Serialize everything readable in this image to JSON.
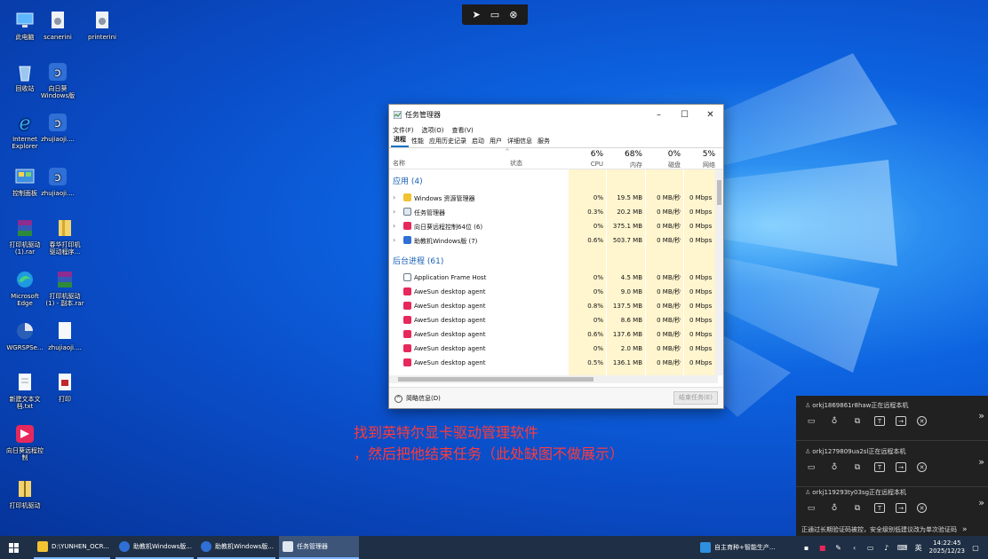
{
  "colors": {
    "desktop": "#0a4fd8",
    "accent": "#1a73c7",
    "instruction_text": "#ff3a3a",
    "taskbar": "#1f2f45",
    "panel": "#212121",
    "resource_highlight": "#fff5cf"
  },
  "desktop": {
    "icons": [
      {
        "label": "此电脑",
        "icon": "computer-icon"
      },
      {
        "label": "scanerini",
        "icon": "ini-file-icon"
      },
      {
        "label": "printerini",
        "icon": "ini-file-icon"
      },
      {
        "label": "回收站",
        "icon": "recycle-bin-icon"
      },
      {
        "label": "向日葵\nWindows版",
        "icon": "sunlogin-icon"
      },
      {
        "label": "Internet\nExplorer",
        "icon": "ie-icon"
      },
      {
        "label": "zhujiaoji....",
        "icon": "sunlogin-icon"
      },
      {
        "label": "控制面板",
        "icon": "control-panel-icon"
      },
      {
        "label": "zhujiaoji....",
        "icon": "sunlogin-icon"
      },
      {
        "label": "打印机驱动\n(1).rar",
        "icon": "rar-icon"
      },
      {
        "label": "春华打印机\n驱动程序...",
        "icon": "folder-icon"
      },
      {
        "label": "Microsoft\nEdge",
        "icon": "edge-icon"
      },
      {
        "label": "打印机驱动\n(1) - 副本.rar",
        "icon": "rar-icon"
      },
      {
        "label": "WGRSPSe...",
        "icon": "wgrsp-icon"
      },
      {
        "label": "zhujiaoji....",
        "icon": "file-icon"
      },
      {
        "label": "新建文本文\n档.txt",
        "icon": "text-file-icon"
      },
      {
        "label": "打印",
        "icon": "print-doc-icon"
      },
      {
        "label": "向日葵远程控\n制",
        "icon": "sunlogin-remote-icon"
      },
      {
        "label": "打印机驱动",
        "icon": "zip-folder-icon"
      }
    ]
  },
  "remote_toolbar": {
    "icons": [
      "pointer-icon",
      "screen-icon",
      "close-circle-icon"
    ]
  },
  "task_manager": {
    "title": "任务管理器",
    "menu": [
      "文件(F)",
      "选项(O)",
      "查看(V)"
    ],
    "tabs": [
      "进程",
      "性能",
      "应用历史记录",
      "启动",
      "用户",
      "详细信息",
      "服务"
    ],
    "active_tab": "进程",
    "header": {
      "name": "名称",
      "status": "状态",
      "cpu_pct": "6%",
      "cpu": "CPU",
      "mem_pct": "68%",
      "mem": "内存",
      "disk_pct": "0%",
      "disk": "磁盘",
      "net_pct": "5%",
      "net": "网络"
    },
    "groups": {
      "apps": "应用 (4)",
      "background": "后台进程 (61)"
    },
    "apps": [
      {
        "name": "Windows 资源管理器",
        "cpu": "0%",
        "mem": "19.5 MB",
        "disk": "0 MB/秒",
        "net": "0 Mbps",
        "icon": "explorer-icon"
      },
      {
        "name": "任务管理器",
        "cpu": "0.3%",
        "mem": "20.2 MB",
        "disk": "0 MB/秒",
        "net": "0 Mbps",
        "icon": "taskmgr-icon"
      },
      {
        "name": "向日葵远程控制64位 (6)",
        "cpu": "0%",
        "mem": "375.1 MB",
        "disk": "0 MB/秒",
        "net": "0 Mbps",
        "icon": "sunlogin-icon"
      },
      {
        "name": "助教机Windows版 (7)",
        "cpu": "0.6%",
        "mem": "503.7 MB",
        "disk": "0 MB/秒",
        "net": "0 Mbps",
        "icon": "zhujiaoji-icon"
      }
    ],
    "background": [
      {
        "name": "Application Frame Host",
        "cpu": "0%",
        "mem": "4.5 MB",
        "disk": "0 MB/秒",
        "net": "0 Mbps",
        "icon": "app-frame-icon"
      },
      {
        "name": "AweSun desktop agent",
        "cpu": "0%",
        "mem": "9.0 MB",
        "disk": "0 MB/秒",
        "net": "0 Mbps",
        "icon": "awesun-icon"
      },
      {
        "name": "AweSun desktop agent",
        "cpu": "0.8%",
        "mem": "137.5 MB",
        "disk": "0 MB/秒",
        "net": "0 Mbps",
        "icon": "awesun-icon"
      },
      {
        "name": "AweSun desktop agent",
        "cpu": "0%",
        "mem": "8.6 MB",
        "disk": "0 MB/秒",
        "net": "0 Mbps",
        "icon": "awesun-icon"
      },
      {
        "name": "AweSun desktop agent",
        "cpu": "0.6%",
        "mem": "137.6 MB",
        "disk": "0 MB/秒",
        "net": "0 Mbps",
        "icon": "awesun-icon"
      },
      {
        "name": "AweSun desktop agent",
        "cpu": "0%",
        "mem": "2.0 MB",
        "disk": "0 MB/秒",
        "net": "0 Mbps",
        "icon": "awesun-icon"
      },
      {
        "name": "AweSun desktop agent",
        "cpu": "0.5%",
        "mem": "136.1 MB",
        "disk": "0 MB/秒",
        "net": "0 Mbps",
        "icon": "awesun-icon"
      }
    ],
    "footer": {
      "less_details": "简略信息(D)",
      "end_task": "结束任务(E)"
    }
  },
  "instruction": {
    "line1": "找到英特尔显卡驱动管理软件",
    "line2": "，然后把他结束任务（此处缺图不做展示）"
  },
  "sessions": [
    {
      "text": "orkj1869861r8haw正在远程本机"
    },
    {
      "text": "orkj1279809ua2sl正在远程本机"
    },
    {
      "text": "orkj119293ty03sg正在远程本机"
    }
  ],
  "session_warning": "正通过长期验证码被控，安全级别低建议改为单次验证码",
  "taskbar": {
    "items": [
      {
        "label": "D:\\YUNHEN_OCR...",
        "icon": "folder-icon"
      },
      {
        "label": "助教机Windows版...",
        "icon": "zhujiaoji-icon"
      },
      {
        "label": "助教机Windows版...",
        "icon": "zhujiaoji-icon"
      },
      {
        "label": "任务管理器",
        "icon": "taskmgr-icon"
      }
    ],
    "notify_app": "自主育种+智能生产...",
    "ime": "英",
    "time": "14:22:45",
    "date": "2025/12/23"
  }
}
